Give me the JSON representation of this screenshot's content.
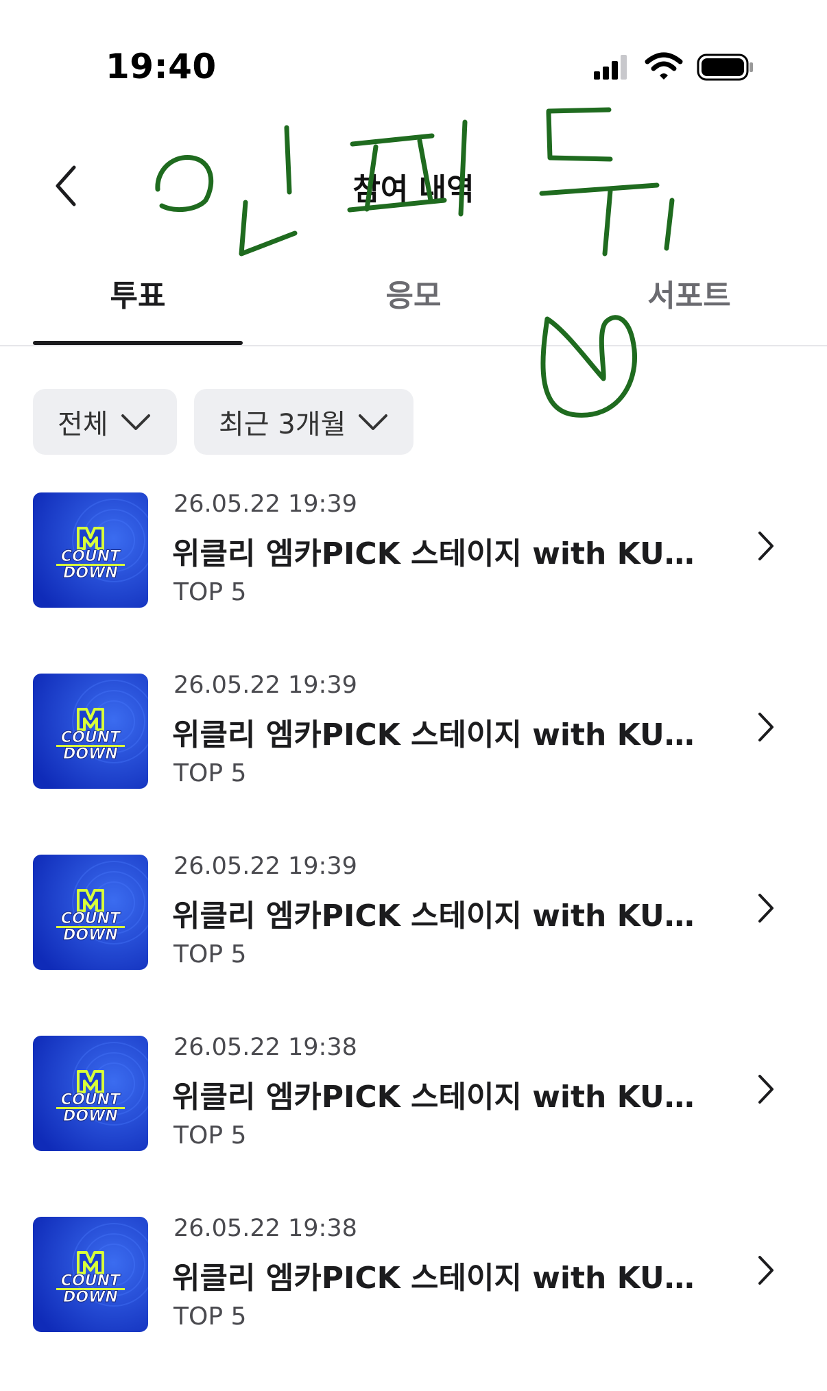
{
  "status_bar": {
    "time": "19:40"
  },
  "header": {
    "title": "참여 내역"
  },
  "tabs": [
    {
      "label": "투표",
      "active": true
    },
    {
      "label": "응모",
      "active": false
    },
    {
      "label": "서포트",
      "active": false
    }
  ],
  "filters": {
    "all_label": "전체",
    "period_label": "최근 3개월"
  },
  "list": {
    "items": [
      {
        "date": "26.05.22 19:39",
        "title": "위클리 엠카PICK 스테이지 with KURIMU",
        "subtitle": "TOP 5"
      },
      {
        "date": "26.05.22 19:39",
        "title": "위클리 엠카PICK 스테이지 with KURIMU",
        "subtitle": "TOP 5"
      },
      {
        "date": "26.05.22 19:39",
        "title": "위클리 엠카PICK 스테이지 with KURIMU",
        "subtitle": "TOP 5"
      },
      {
        "date": "26.05.22 19:38",
        "title": "위클리 엠카PICK 스테이지 with KURIMU",
        "subtitle": "TOP 5"
      },
      {
        "date": "26.05.22 19:38",
        "title": "위클리 엠카PICK 스테이지 with KURIMU",
        "subtitle": "TOP 5"
      }
    ]
  },
  "thumbnail": {
    "logo_line1": "COUNT",
    "logo_line2": "DOWN"
  },
  "handwriting": {
    "text": "인피듀"
  },
  "colors": {
    "accent_dark": "#1c1c1e",
    "tab_inactive": "#6b6b70",
    "filter_bg": "#eeeff2",
    "thumb_blue": "#1a3fcf",
    "ink_green": "#1f6b1f"
  }
}
